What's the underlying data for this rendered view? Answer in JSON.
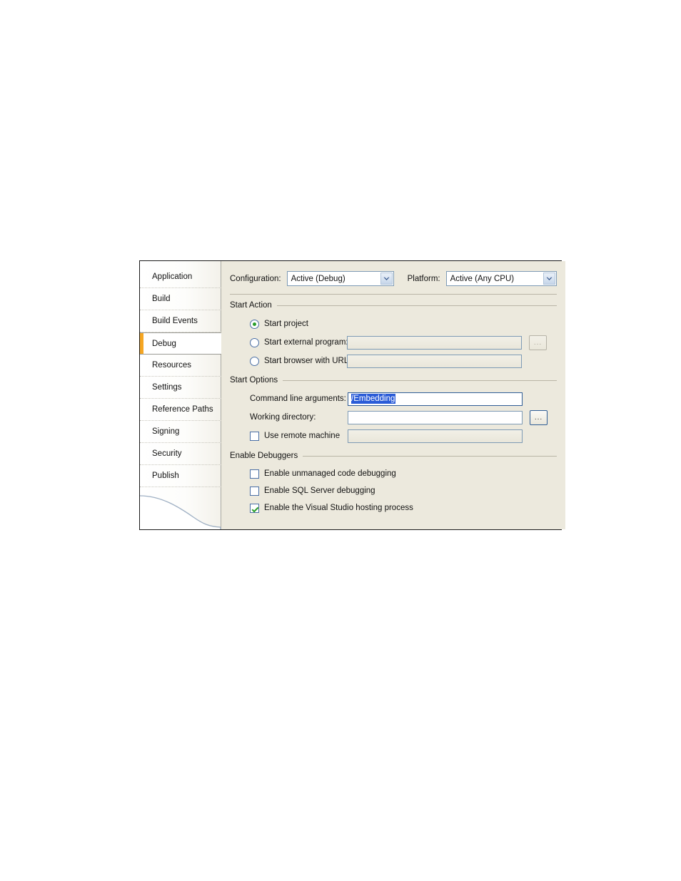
{
  "dialog": {
    "tabs": [
      {
        "label": "Application",
        "selected": false
      },
      {
        "label": "Build",
        "selected": false
      },
      {
        "label": "Build Events",
        "selected": false
      },
      {
        "label": "Debug",
        "selected": true
      },
      {
        "label": "Resources",
        "selected": false
      },
      {
        "label": "Settings",
        "selected": false
      },
      {
        "label": "Reference Paths",
        "selected": false
      },
      {
        "label": "Signing",
        "selected": false
      },
      {
        "label": "Security",
        "selected": false
      },
      {
        "label": "Publish",
        "selected": false
      }
    ],
    "config_bar": {
      "configuration_label": "Configuration:",
      "configuration_value": "Active (Debug)",
      "platform_label": "Platform:",
      "platform_value": "Active (Any CPU)"
    },
    "start_action": {
      "title": "Start Action",
      "options": [
        {
          "label": "Start project",
          "checked": true
        },
        {
          "label": "Start external program:",
          "checked": false,
          "value": ""
        },
        {
          "label": "Start browser with URL:",
          "checked": false,
          "value": ""
        }
      ],
      "browse_label": "..."
    },
    "start_options": {
      "title": "Start Options",
      "command_line_label": "Command line arguments:",
      "command_line_value": "/Embedding",
      "working_directory_label": "Working directory:",
      "working_directory_value": "",
      "working_directory_browse": "...",
      "use_remote_machine_label": "Use remote machine",
      "use_remote_machine_checked": false,
      "remote_machine_value": ""
    },
    "enable_debuggers": {
      "title": "Enable Debuggers",
      "items": [
        {
          "label": "Enable unmanaged code debugging",
          "checked": false
        },
        {
          "label": "Enable SQL Server debugging",
          "checked": false
        },
        {
          "label": "Enable the Visual Studio hosting process",
          "checked": true
        }
      ]
    },
    "colors": {
      "dialog_background": "#ece9dd",
      "selected_tab_accent": "#f5a623",
      "selection_highlight": "#2a5bd7",
      "check_green": "#2a9d2a",
      "field_border": "#7d9ab5"
    }
  }
}
